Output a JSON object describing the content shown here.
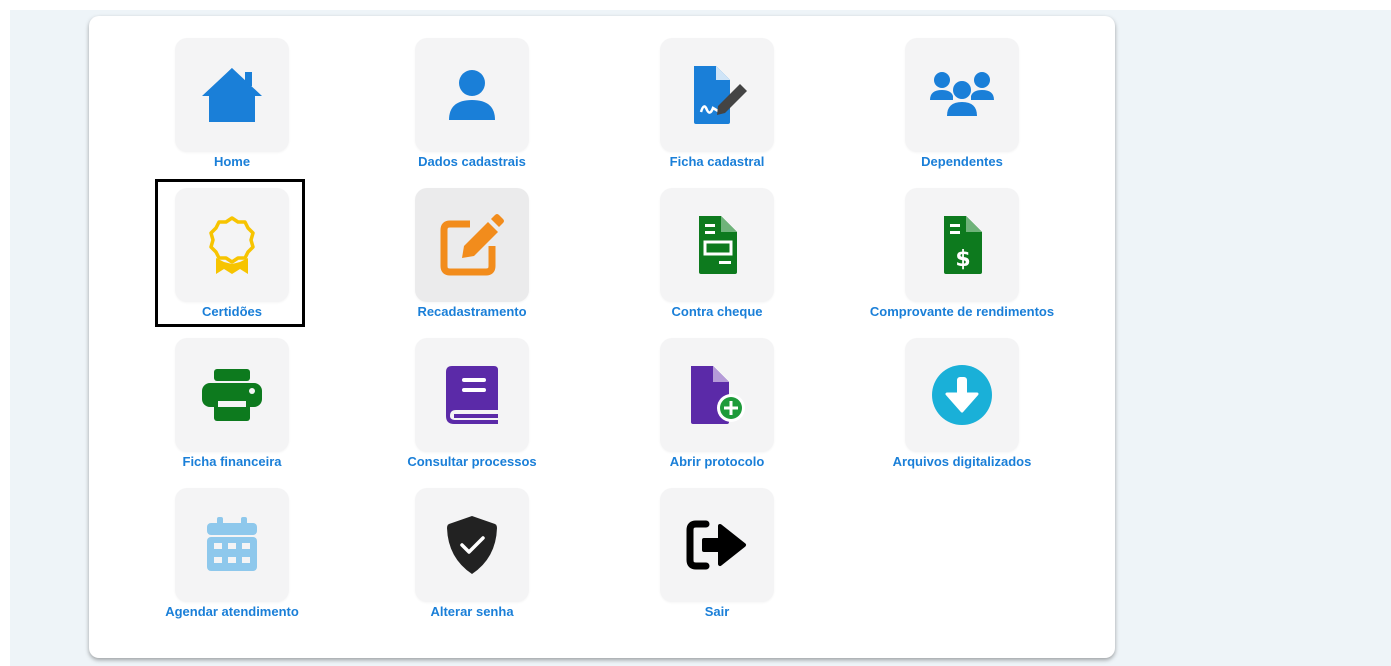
{
  "menu": {
    "items": [
      {
        "label": "Home",
        "icon": "house-icon",
        "color": "#1a7fd8"
      },
      {
        "label": "Dados cadastrais",
        "icon": "user-icon",
        "color": "#1a7fd8"
      },
      {
        "label": "Ficha cadastral",
        "icon": "file-signature-icon",
        "color": "#1a7fd8"
      },
      {
        "label": "Dependentes",
        "icon": "users-icon",
        "color": "#1a7fd8"
      },
      {
        "label": "Certidões",
        "icon": "award-icon",
        "color": "#f7c400"
      },
      {
        "label": "Recadastramento",
        "icon": "edit-icon",
        "color": "#f28c1c"
      },
      {
        "label": "Contra cheque",
        "icon": "invoice-icon",
        "color": "#0d7a1e"
      },
      {
        "label": "Comprovante de rendimentos",
        "icon": "invoice-dollar-icon",
        "color": "#0d7a1e"
      },
      {
        "label": "Ficha financeira",
        "icon": "printer-icon",
        "color": "#0d7a1e"
      },
      {
        "label": "Consultar processos",
        "icon": "book-icon",
        "color": "#5b2aa8"
      },
      {
        "label": "Abrir protocolo",
        "icon": "file-plus-icon",
        "color": "#5b2aa8"
      },
      {
        "label": "Arquivos digitalizados",
        "icon": "download-icon",
        "color": "#1ab0d8"
      },
      {
        "label": "Agendar atendimento",
        "icon": "calendar-icon",
        "color": "#8ec8ec"
      },
      {
        "label": "Alterar senha",
        "icon": "shield-check-icon",
        "color": "#222222"
      },
      {
        "label": "Sair",
        "icon": "sign-out-icon",
        "color": "#000000"
      }
    ],
    "highlighted": "Certidões",
    "label_color": "#1a7fd8"
  }
}
